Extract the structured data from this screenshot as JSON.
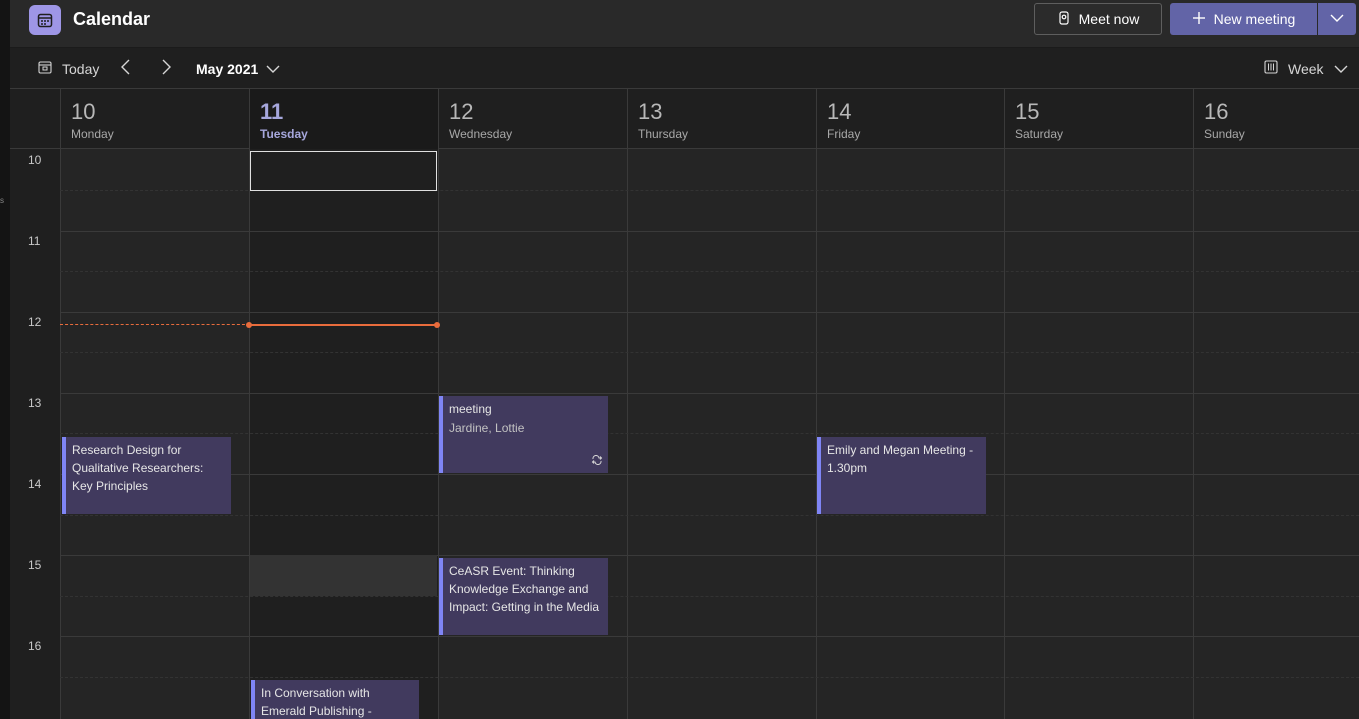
{
  "header": {
    "title": "Calendar",
    "meet_now_label": "Meet now",
    "new_meeting_label": "New meeting"
  },
  "toolbar": {
    "today_label": "Today",
    "month_label": "May 2021",
    "view_label": "Week"
  },
  "days": [
    {
      "num": "10",
      "name": "Monday"
    },
    {
      "num": "11",
      "name": "Tuesday"
    },
    {
      "num": "12",
      "name": "Wednesday"
    },
    {
      "num": "13",
      "name": "Thursday"
    },
    {
      "num": "14",
      "name": "Friday"
    },
    {
      "num": "15",
      "name": "Saturday"
    },
    {
      "num": "16",
      "name": "Sunday"
    }
  ],
  "hours": [
    "10",
    "11",
    "12",
    "13",
    "14",
    "15",
    "16"
  ],
  "events": [
    {
      "title": "Research Design for Qualitative Researchers: Key Principles",
      "subtitle": ""
    },
    {
      "title": "meeting",
      "subtitle": "Jardine, Lottie"
    },
    {
      "title": "Emily and Megan Meeting - 1.30pm",
      "subtitle": ""
    },
    {
      "title": "CeASR Event: Thinking Knowledge Exchange and Impact: Getting in the Media",
      "subtitle": ""
    },
    {
      "title": "In Conversation with Emerald Publishing - Careers",
      "subtitle": ""
    }
  ],
  "colors": {
    "accent": "#6264a7",
    "event_bg": "#413a5e",
    "event_border": "#7f85f5",
    "now_line": "#e96c3c"
  }
}
